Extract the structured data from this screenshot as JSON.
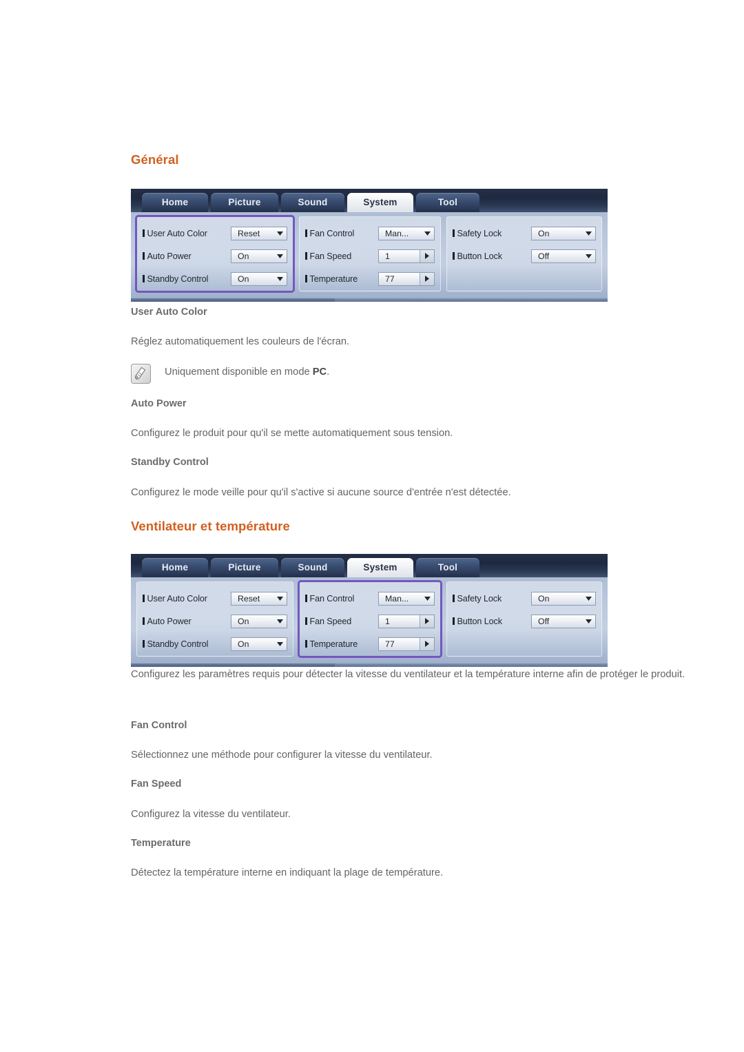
{
  "theme": {
    "heading_color": "#d1601f",
    "body_color": "#646464",
    "highlight_color": "#7357c0",
    "osd_tabbar_color": "#243046"
  },
  "sections": [
    {
      "heading": "Général",
      "osd_highlight": "column-a",
      "items": [
        {
          "title": "User Auto Color",
          "description": "Réglez automatiquement les couleurs de l'écran.",
          "note_prefix": "Uniquement disponible en mode ",
          "note_bold": "PC",
          "note_suffix": "."
        },
        {
          "title": "Auto Power",
          "description": "Configurez le produit pour qu'il se mette automatiquement sous tension."
        },
        {
          "title": "Standby Control",
          "description": "Configurez le mode veille pour qu'il s'active si aucune source d'entrée n'est détectée."
        }
      ]
    },
    {
      "heading": "Ventilateur et température",
      "osd_highlight": "column-b",
      "intro": "Configurez les paramètres requis pour détecter la vitesse du ventilateur et la température interne afin de protéger le produit.",
      "items": [
        {
          "title": "Fan Control",
          "description": "Sélectionnez une méthode pour configurer la vitesse du ventilateur."
        },
        {
          "title": "Fan Speed",
          "description": "Configurez la vitesse du ventilateur."
        },
        {
          "title": "Temperature",
          "description": "Détectez la température interne en indiquant la plage de température."
        }
      ]
    }
  ],
  "osd": {
    "tabs": [
      {
        "label": "Home",
        "active": false
      },
      {
        "label": "Picture",
        "active": false
      },
      {
        "label": "Sound",
        "active": false
      },
      {
        "label": "System",
        "active": true
      },
      {
        "label": "Tool",
        "active": false
      }
    ],
    "columns": {
      "a": [
        {
          "label": "User Auto Color",
          "value": "Reset",
          "control": "dropdown"
        },
        {
          "label": "Auto Power",
          "value": "On",
          "control": "dropdown"
        },
        {
          "label": "Standby Control",
          "value": "On",
          "control": "dropdown"
        }
      ],
      "b": [
        {
          "label": "Fan Control",
          "value": "Man...",
          "control": "dropdown"
        },
        {
          "label": "Fan Speed",
          "value": "1",
          "control": "stepper"
        },
        {
          "label": "Temperature",
          "value": "77",
          "control": "stepper"
        }
      ],
      "c": [
        {
          "label": "Safety Lock",
          "value": "On",
          "control": "dropdown"
        },
        {
          "label": "Button Lock",
          "value": "Off",
          "control": "dropdown"
        }
      ]
    },
    "icons": {
      "caret": "chevron-down-icon",
      "step": "chevron-right-icon"
    }
  }
}
